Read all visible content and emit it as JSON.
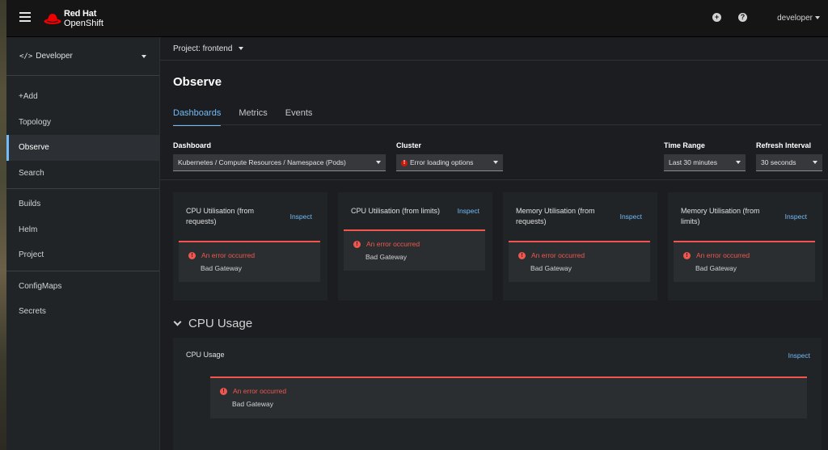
{
  "masthead": {
    "brand_line1": "Red Hat",
    "brand_line2": "OpenShift",
    "add_icon": "plus-circle-icon",
    "help_icon": "question-circle-icon",
    "user": "developer"
  },
  "sidebar": {
    "perspective": "Developer",
    "items": [
      "+Add",
      "Topology",
      "Observe",
      "Search",
      "Builds",
      "Helm",
      "Project",
      "ConfigMaps",
      "Secrets"
    ],
    "active": "Observe"
  },
  "project_bar": {
    "label": "Project: frontend"
  },
  "page": {
    "title": "Observe",
    "tabs": [
      "Dashboards",
      "Metrics",
      "Events"
    ],
    "active_tab": "Dashboards"
  },
  "filters": {
    "dashboard": {
      "label": "Dashboard",
      "value": "Kubernetes / Compute Resources / Namespace (Pods)"
    },
    "cluster": {
      "label": "Cluster",
      "value": "Error loading options"
    },
    "time_range": {
      "label": "Time Range",
      "value": "Last 30 minutes"
    },
    "refresh": {
      "label": "Refresh Interval",
      "value": "30 seconds"
    }
  },
  "cards": [
    {
      "title": "CPU Utilisation (from requests)",
      "inspect": "Inspect",
      "error_title": "An error occurred",
      "error_body": "Bad Gateway"
    },
    {
      "title": "CPU Utilisation (from limits)",
      "inspect": "Inspect",
      "error_title": "An error occurred",
      "error_body": "Bad Gateway"
    },
    {
      "title": "Memory Utilisation (from requests)",
      "inspect": "Inspect",
      "error_title": "An error occurred",
      "error_body": "Bad Gateway"
    },
    {
      "title": "Memory Utilisation (from limits)",
      "inspect": "Inspect",
      "error_title": "An error occurred",
      "error_body": "Bad Gateway"
    }
  ],
  "section": {
    "title": "CPU Usage",
    "card_title": "CPU Usage",
    "inspect": "Inspect",
    "error_title": "An error occurred",
    "error_body": "Bad Gateway"
  },
  "colors": {
    "accent": "#73bcf7",
    "error": "#f0564d",
    "brand_red": "#ee0000"
  }
}
